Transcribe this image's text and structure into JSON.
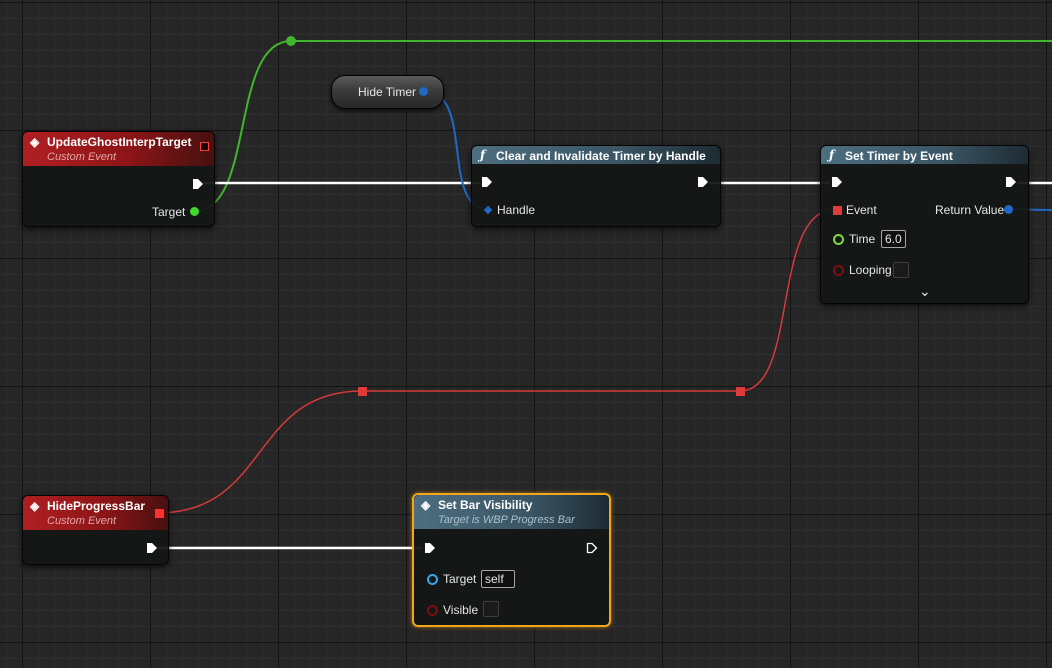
{
  "nodes": {
    "update_ghost": {
      "title": "UpdateGhostInterpTarget",
      "subtitle": "Custom Event",
      "target_label": "Target"
    },
    "hide_timer": {
      "label": "Hide Timer"
    },
    "clear_timer": {
      "title": "Clear and Invalidate Timer by Handle",
      "handle_label": "Handle"
    },
    "set_timer": {
      "title": "Set Timer by Event",
      "event_label": "Event",
      "return_label": "Return Value",
      "time_label": "Time",
      "time_value": "6.0",
      "looping_label": "Looping",
      "expand_glyph": "⌄"
    },
    "hide_progress": {
      "title": "HideProgressBar",
      "subtitle": "Custom Event"
    },
    "set_bar_visibility": {
      "title": "Set Bar Visibility",
      "subtitle": "Target is WBP Progress Bar",
      "target_label": "Target",
      "target_value": "self",
      "visible_label": "Visible"
    }
  },
  "colors": {
    "exec_wire": "#ffffff",
    "object_wire": "#3fb62b",
    "timer_handle_wire": "#1f68c8",
    "delegate_wire": "#d63a3a",
    "event_header": "#b01f22",
    "function_header": "#4c6e80",
    "selection": "#f2a71b"
  },
  "icons": {
    "event": "diamond-event-icon",
    "function": "function-f-icon",
    "exec": "exec-arrow-icon"
  }
}
